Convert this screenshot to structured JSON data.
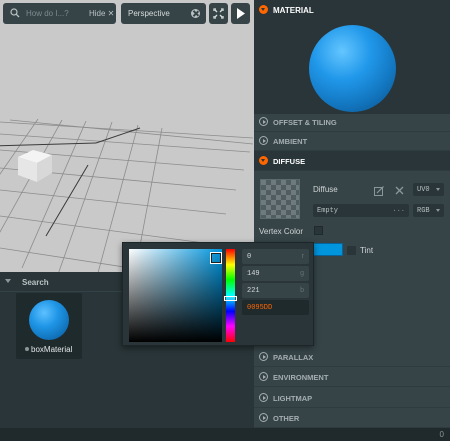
{
  "toolbar": {
    "search_placeholder": "How do I...?",
    "hide_label": "Hide",
    "camera": "Perspective"
  },
  "assets": {
    "header": "Search",
    "items": [
      {
        "name": "boxMaterial",
        "icon": "sphere-preview"
      }
    ]
  },
  "inspector": {
    "title": "MATERIAL",
    "sections": {
      "offset_tiling": "OFFSET & TILING",
      "ambient": "AMBIENT",
      "diffuse": "DIFFUSE",
      "parallax": "PARALLAX",
      "environment": "ENVIRONMENT",
      "lightmap": "LIGHTMAP",
      "other": "OTHER"
    },
    "diffuse": {
      "label": "Diffuse",
      "uv_channel": "UV0",
      "texture": "Empty",
      "texture_more": "...",
      "channels": "RGB",
      "vertex_color_label": "Vertex Color",
      "tint_label": "Tint",
      "color": "#0095dd"
    }
  },
  "color_picker": {
    "r": "0",
    "g": "149",
    "b": "221",
    "r_key": "r",
    "g_key": "g",
    "b_key": "b",
    "hex": "0095DD"
  },
  "status": {
    "count": "0"
  },
  "colors": {
    "accent": "#ff6600",
    "material": "#0095dd",
    "panel": "#364448",
    "panel_dark": "#293538"
  }
}
